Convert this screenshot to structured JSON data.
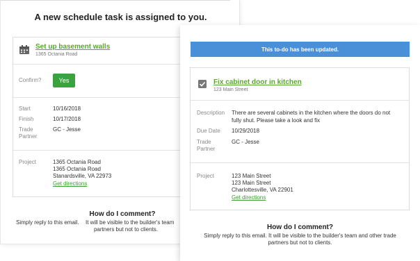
{
  "back_email": {
    "heading": "A new schedule task is assigned to you.",
    "task": {
      "title": "Set up basement walls",
      "address": "1365 Octania Road",
      "icon": "calendar-icon"
    },
    "confirm_label": "Confirm?",
    "confirm_button": "Yes",
    "fields": {
      "start_label": "Start",
      "start_value": "10/16/2018",
      "finish_label": "Finish",
      "finish_value": "10/17/2018",
      "trade_label_1": "Trade",
      "trade_label_2": "Partner",
      "trade_value": "GC - Jesse"
    },
    "project": {
      "label": "Project",
      "line1": "1365 Octania Road",
      "line2": "1365 Octania Road",
      "line3": "Stanardsville, VA 22973",
      "directions": "Get directions"
    },
    "comment": {
      "title": "How do I comment?",
      "prefix": "Simply reply to this email.",
      "body": "It will be visible to the builder's team",
      "body2": "partners but not to clients."
    }
  },
  "front_email": {
    "banner": "This to-do has been updated.",
    "task": {
      "title": "Fix cabinet door in kitchen",
      "address": "123 Main Street",
      "icon": "checkbox-icon"
    },
    "fields": {
      "description_label": "Description",
      "description_line1": "There are several cabinets in the kitchen where the doors do not",
      "description_line2": "fully shut. Please take a look and fix",
      "due_label": "Due Date",
      "due_value": "10/29/2018",
      "trade_label_1": "Trade",
      "trade_label_2": "Partner",
      "trade_value": "GC - Jesse"
    },
    "project": {
      "label": "Project",
      "line1": "123 Main Street",
      "line2": "123 Main Street",
      "line3": "Charlottesville, VA 22901",
      "directions": "Get directions"
    },
    "comment": {
      "title": "How do I comment?",
      "line1": "Simply reply to this email. It will be visible to the builder's team and other trade",
      "line2": "partners but not to clients."
    }
  },
  "colors": {
    "green": "#3aa33f",
    "link_green": "#5aa52f",
    "banner_blue": "#4a90d9"
  }
}
